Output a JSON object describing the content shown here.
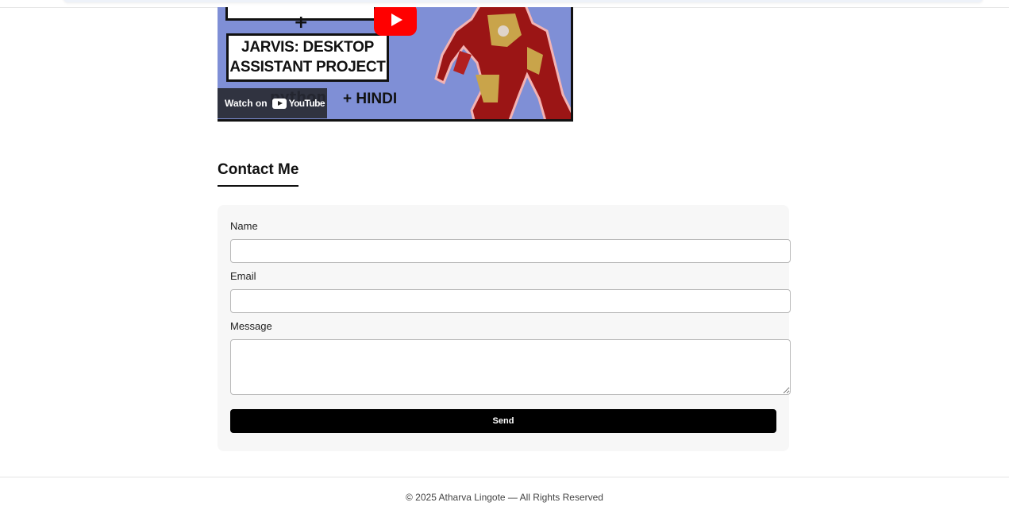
{
  "video": {
    "thumbnail_plus": "+",
    "thumbnail_title_line1": "JARVIS: DESKTOP",
    "thumbnail_title_line2": "ASSISTANT PROJECT",
    "thumbnail_python": "python",
    "thumbnail_hindi": "+ HINDI",
    "watch_on_label": "Watch on",
    "youtube_label": "YouTube",
    "play_icon": "play-icon",
    "accent_color": "#ff0000"
  },
  "contact": {
    "heading": "Contact Me",
    "name_label": "Name",
    "name_value": "",
    "email_label": "Email",
    "email_value": "",
    "message_label": "Message",
    "message_value": "",
    "send_label": "Send"
  },
  "footer": {
    "text": "© 2025 Atharva Lingote — All Rights Reserved"
  }
}
